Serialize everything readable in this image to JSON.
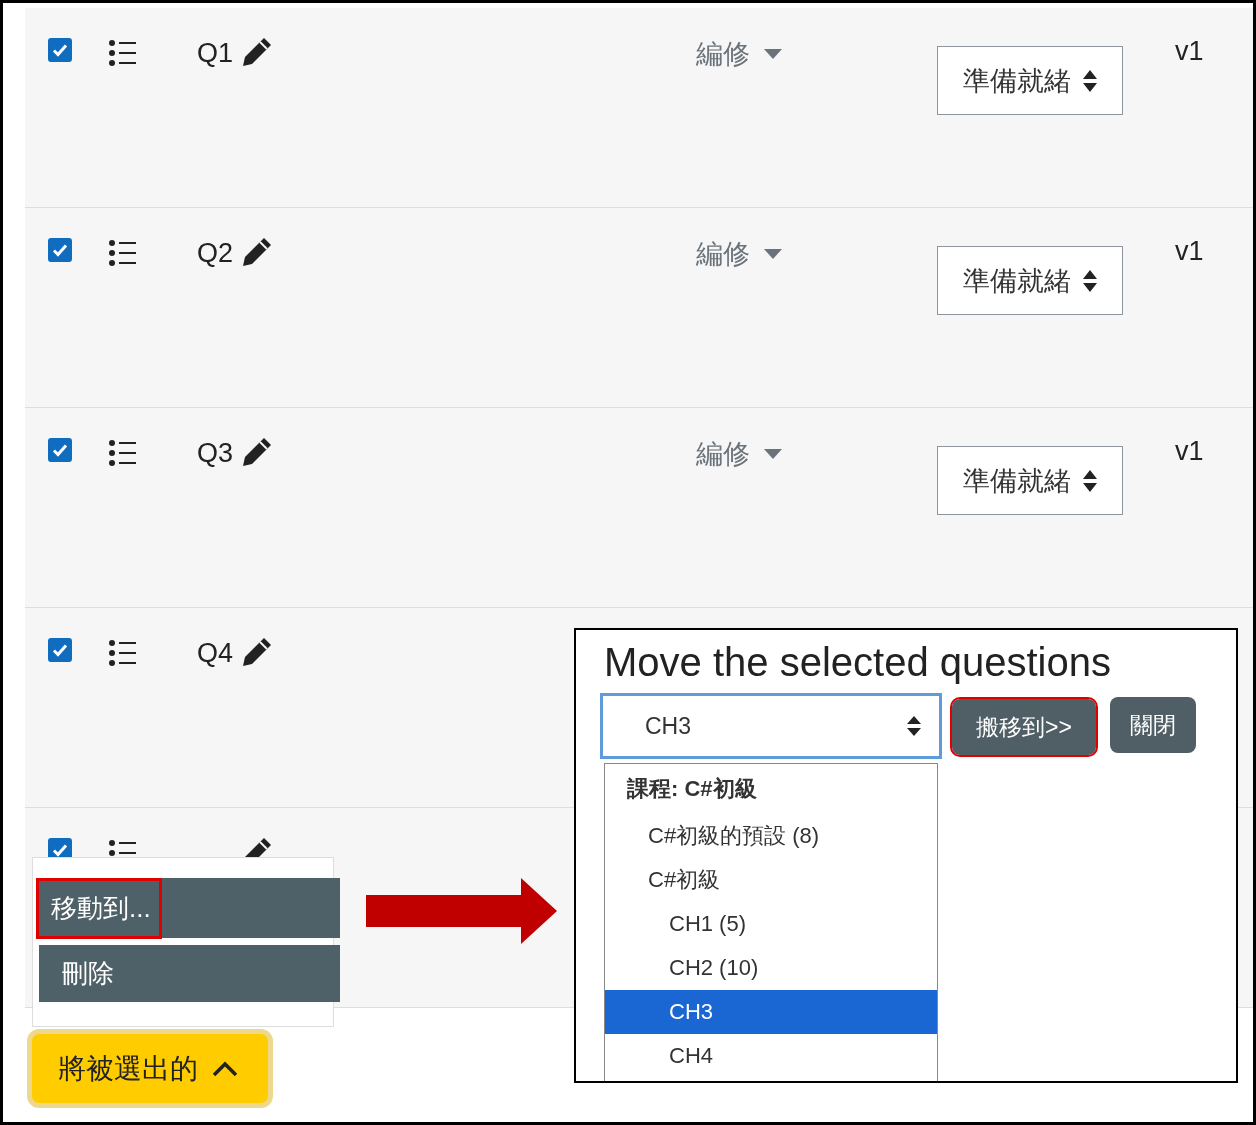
{
  "questions": [
    {
      "checked": true,
      "name": "Q1",
      "edit": "編修",
      "status": "準備就緒",
      "version": "v1"
    },
    {
      "checked": true,
      "name": "Q2",
      "edit": "編修",
      "status": "準備就緒",
      "version": "v1"
    },
    {
      "checked": true,
      "name": "Q3",
      "edit": "編修",
      "status": "準備就緒",
      "version": "v1"
    },
    {
      "checked": true,
      "name": "Q4"
    },
    {
      "checked": true
    }
  ],
  "selection_menu": {
    "items": [
      {
        "label": "移動到...",
        "highlighted": true
      },
      {
        "label": "刪除",
        "highlighted": false
      }
    ]
  },
  "toggle_button": {
    "label": "將被選出的",
    "expanded": true
  },
  "move_dialog": {
    "title": "Move the selected questions",
    "select": {
      "value": "CH3"
    },
    "options": [
      {
        "label": "課程: C#初級",
        "kind": "group",
        "children": [
          {
            "label": "C#初級的預設 (8)",
            "selected": false
          },
          {
            "label": "C#初級",
            "selected": false,
            "children": [
              {
                "label": "CH1 (5)",
                "selected": false
              },
              {
                "label": "CH2 (10)",
                "selected": false
              },
              {
                "label": "CH3",
                "selected": true
              },
              {
                "label": "CH4",
                "selected": false
              }
            ]
          }
        ]
      }
    ],
    "buttons": [
      {
        "label": "搬移到>>",
        "highlighted": true
      },
      {
        "label": "關閉",
        "highlighted": false
      }
    ]
  }
}
